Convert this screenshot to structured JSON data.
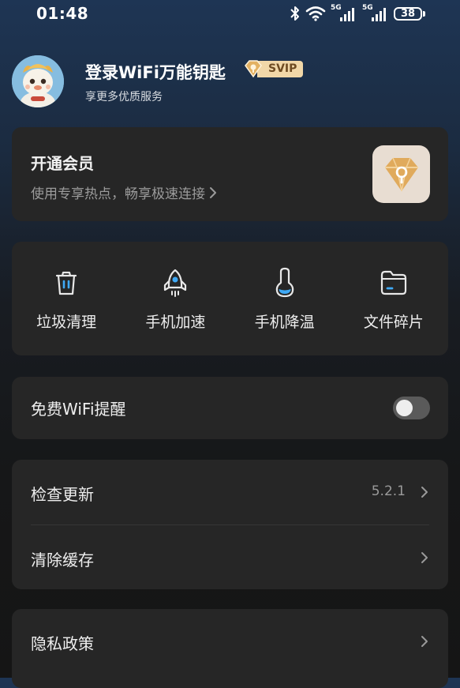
{
  "status_bar": {
    "time": "01:48",
    "network1": "5G",
    "network2": "5G",
    "battery": "38",
    "icons": [
      "bluetooth-icon",
      "wifi-icon",
      "signal-icon",
      "battery-icon"
    ]
  },
  "profile": {
    "title": "登录WiFi万能钥匙",
    "badge": "SVIP",
    "subtitle": "享更多优质服务"
  },
  "vip": {
    "title": "开通会员",
    "subtitle": "使用专享热点，畅享极速连接"
  },
  "tools": [
    {
      "label": "垃圾清理",
      "icon": "trash-icon"
    },
    {
      "label": "手机加速",
      "icon": "rocket-icon"
    },
    {
      "label": "手机降温",
      "icon": "thermometer-icon"
    },
    {
      "label": "文件碎片",
      "icon": "folder-icon"
    }
  ],
  "wifi_reminder": {
    "label": "免费WiFi提醒",
    "enabled": false
  },
  "settings": {
    "check_update": {
      "label": "检查更新",
      "value": "5.2.1"
    },
    "clear_cache": {
      "label": "清除缓存"
    }
  },
  "privacy": {
    "label": "隐私政策"
  },
  "colors": {
    "accent_gold": "#f1d7a8",
    "badge_text": "#6e4b22",
    "icon_blue": "#3fa9f5",
    "card_bg": "#262626"
  }
}
